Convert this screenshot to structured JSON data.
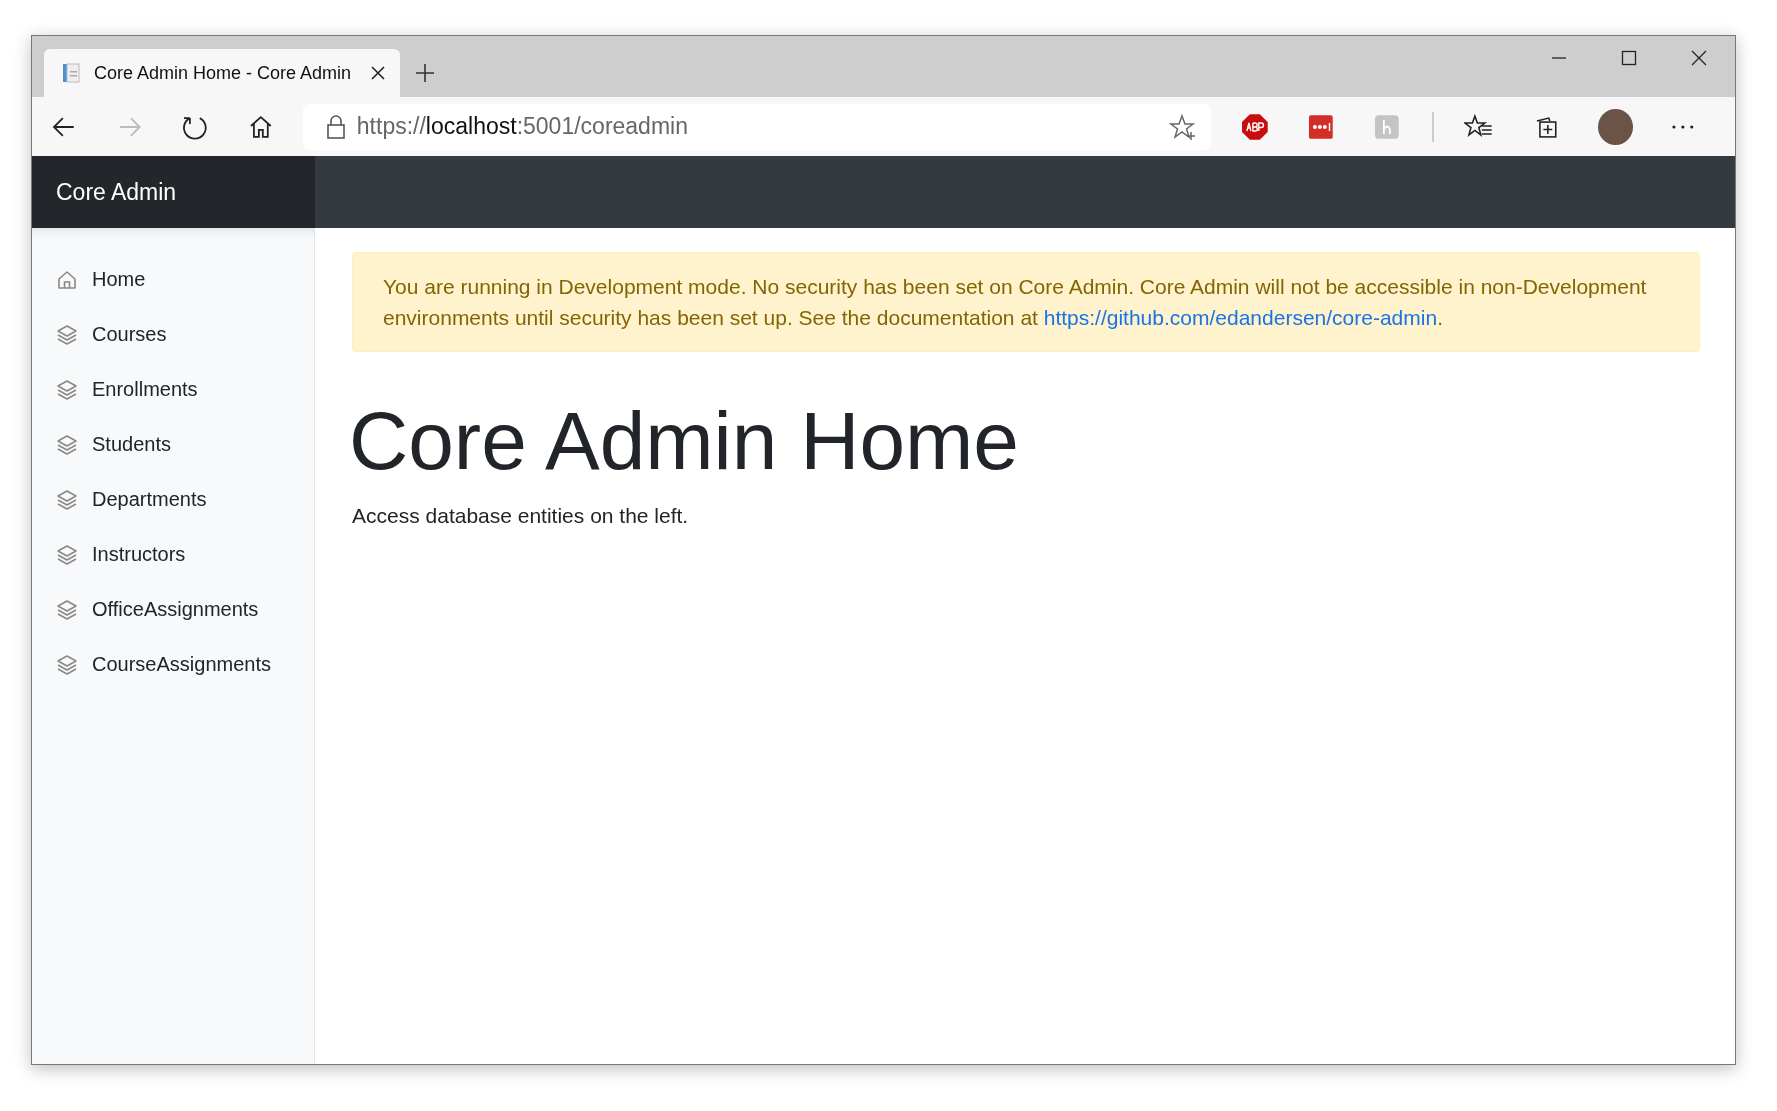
{
  "browser": {
    "tab": {
      "title": "Core Admin Home - Core Admin",
      "selected": true
    },
    "url": {
      "scheme": "https://",
      "host": "localhost",
      "rest": ":5001/coreadmin"
    }
  },
  "header": {
    "brand": "Core Admin"
  },
  "sidebar": {
    "items": [
      {
        "label": "Home",
        "kind": "home"
      },
      {
        "label": "Courses",
        "kind": "entity"
      },
      {
        "label": "Enrollments",
        "kind": "entity"
      },
      {
        "label": "Students",
        "kind": "entity"
      },
      {
        "label": "Departments",
        "kind": "entity"
      },
      {
        "label": "Instructors",
        "kind": "entity"
      },
      {
        "label": "OfficeAssignments",
        "kind": "entity"
      },
      {
        "label": "CourseAssignments",
        "kind": "entity"
      }
    ]
  },
  "alert": {
    "text": "You are running in Development mode. No security has been set on Core Admin. Core Admin will not be accessible in non-Development environments until security has been set up. See the documentation at",
    "link": "https://github.com/edandersen/core-admin",
    "after": "."
  },
  "main": {
    "title": "Core Admin Home",
    "text": "Access database entities on the left."
  }
}
